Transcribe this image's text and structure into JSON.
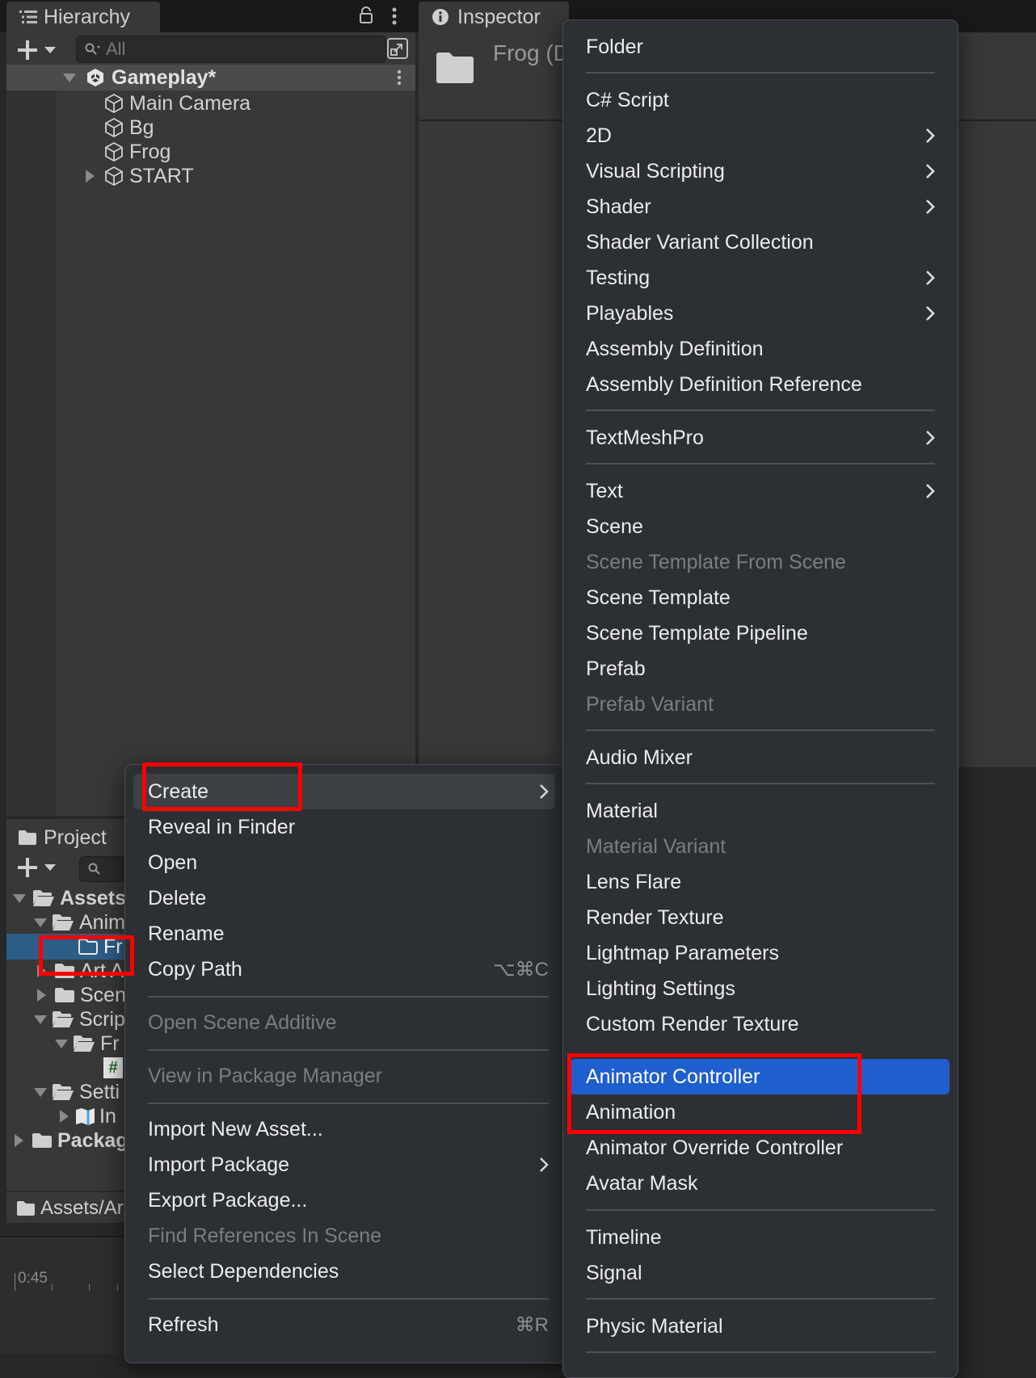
{
  "hierarchy": {
    "tab_label": "Hierarchy",
    "search_placeholder": "All",
    "scene_name": "Gameplay*",
    "objects": [
      "Main Camera",
      "Bg",
      "Frog",
      "START"
    ]
  },
  "inspector": {
    "tab_label": "Inspector",
    "asset_title": "Frog (D"
  },
  "project": {
    "tab_label": "Project",
    "tree": [
      "Assets",
      "Anim",
      "Fr",
      "Art A",
      "Scen",
      "Scrip",
      "Fr",
      "#",
      "Setti",
      "In",
      "Packag"
    ],
    "path": "Assets/Ar",
    "timeline_label": "0:45"
  },
  "context_menu": {
    "items": [
      {
        "label": "Create",
        "chevron": true
      },
      {
        "label": "Reveal in Finder"
      },
      {
        "label": "Open"
      },
      {
        "label": "Delete"
      },
      {
        "label": "Rename"
      },
      {
        "label": "Copy Path",
        "shortcut": "⌥⌘C"
      },
      {
        "label": "Open Scene Additive",
        "disabled": true
      },
      {
        "label": "View in Package Manager",
        "disabled": true
      },
      {
        "label": "Import New Asset..."
      },
      {
        "label": "Import Package",
        "chevron": true
      },
      {
        "label": "Export Package..."
      },
      {
        "label": "Find References In Scene",
        "disabled": true
      },
      {
        "label": "Select Dependencies"
      },
      {
        "label": "Refresh",
        "shortcut": "⌘R"
      }
    ]
  },
  "create_submenu": {
    "items": [
      {
        "label": "Folder"
      },
      {
        "label": "C# Script"
      },
      {
        "label": "2D",
        "chevron": true
      },
      {
        "label": "Visual Scripting",
        "chevron": true
      },
      {
        "label": "Shader",
        "chevron": true
      },
      {
        "label": "Shader Variant Collection"
      },
      {
        "label": "Testing",
        "chevron": true
      },
      {
        "label": "Playables",
        "chevron": true
      },
      {
        "label": "Assembly Definition"
      },
      {
        "label": "Assembly Definition Reference"
      },
      {
        "label": "TextMeshPro",
        "chevron": true
      },
      {
        "label": "Text",
        "chevron": true
      },
      {
        "label": "Scene"
      },
      {
        "label": "Scene Template From Scene",
        "disabled": true
      },
      {
        "label": "Scene Template"
      },
      {
        "label": "Scene Template Pipeline"
      },
      {
        "label": "Prefab"
      },
      {
        "label": "Prefab Variant",
        "disabled": true
      },
      {
        "label": "Audio Mixer"
      },
      {
        "label": "Material"
      },
      {
        "label": "Material Variant",
        "disabled": true
      },
      {
        "label": "Lens Flare"
      },
      {
        "label": "Render Texture"
      },
      {
        "label": "Lightmap Parameters"
      },
      {
        "label": "Lighting Settings"
      },
      {
        "label": "Custom Render Texture"
      },
      {
        "label": "Animator Controller",
        "highlighted": true
      },
      {
        "label": "Animation"
      },
      {
        "label": "Animator Override Controller"
      },
      {
        "label": "Avatar Mask"
      },
      {
        "label": "Timeline"
      },
      {
        "label": "Signal"
      },
      {
        "label": "Physic Material"
      }
    ]
  },
  "colors": {
    "highlight": "#1f5ecf",
    "annotation": "#ff0000",
    "panel": "#383838",
    "menu": "#2c2f33"
  }
}
